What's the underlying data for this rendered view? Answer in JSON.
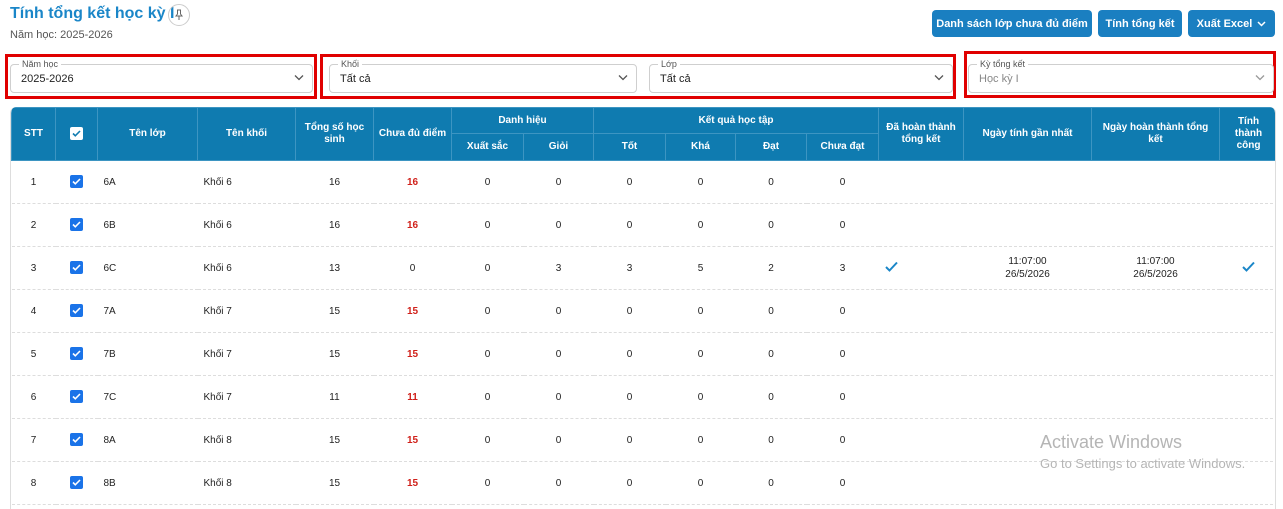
{
  "header": {
    "title": "Tính tổng kết học kỳ I",
    "subtitle": "Năm học: 2025-2026",
    "buttons": {
      "incomplete_list": "Danh sách lớp chưa đủ điểm",
      "calculate": "Tính tổng kết",
      "export": "Xuất Excel"
    }
  },
  "filters": {
    "year": {
      "label": "Năm học",
      "value": "2025-2026"
    },
    "grade": {
      "label": "Khối",
      "value": "Tất cả"
    },
    "class": {
      "label": "Lớp",
      "value": "Tất cả"
    },
    "term": {
      "label": "Kỳ tổng kết",
      "value": "Học kỳ I"
    }
  },
  "table": {
    "headers": {
      "stt": "STT",
      "class_name": "Tên lớp",
      "grade_name": "Tên khối",
      "total_students": "Tổng số học sinh",
      "incomplete": "Chưa đủ điểm",
      "titles": "Danh hiệu",
      "results": "Kết quả học tập",
      "excellent": "Xuất sắc",
      "good": "Giỏi",
      "r_good": "Tốt",
      "r_fair": "Khá",
      "r_pass": "Đạt",
      "r_fail": "Chưa đạt",
      "done": "Đã hoàn thành tổng kết",
      "last_calc": "Ngày tính gần nhất",
      "done_date": "Ngày hoàn thành tổng kết",
      "success": "Tính thành công"
    },
    "rows": [
      {
        "stt": "1",
        "checked": true,
        "class": "6A",
        "grade": "Khối 6",
        "total": "16",
        "incomplete": "16",
        "excellent": "0",
        "good": "0",
        "r_good": "0",
        "r_fair": "0",
        "r_pass": "0",
        "r_fail": "0",
        "done": false,
        "last_time": "",
        "last_date": "",
        "done_time": "",
        "done_date": "",
        "success": false
      },
      {
        "stt": "2",
        "checked": true,
        "class": "6B",
        "grade": "Khối 6",
        "total": "16",
        "incomplete": "16",
        "excellent": "0",
        "good": "0",
        "r_good": "0",
        "r_fair": "0",
        "r_pass": "0",
        "r_fail": "0",
        "done": false,
        "last_time": "",
        "last_date": "",
        "done_time": "",
        "done_date": "",
        "success": false
      },
      {
        "stt": "3",
        "checked": true,
        "class": "6C",
        "grade": "Khối 6",
        "total": "13",
        "incomplete": "0",
        "excellent": "0",
        "good": "3",
        "r_good": "3",
        "r_fair": "5",
        "r_pass": "2",
        "r_fail": "3",
        "done": true,
        "last_time": "11:07:00",
        "last_date": "26/5/2026",
        "done_time": "11:07:00",
        "done_date": "26/5/2026",
        "success": true
      },
      {
        "stt": "4",
        "checked": true,
        "class": "7A",
        "grade": "Khối 7",
        "total": "15",
        "incomplete": "15",
        "excellent": "0",
        "good": "0",
        "r_good": "0",
        "r_fair": "0",
        "r_pass": "0",
        "r_fail": "0",
        "done": false,
        "last_time": "",
        "last_date": "",
        "done_time": "",
        "done_date": "",
        "success": false
      },
      {
        "stt": "5",
        "checked": true,
        "class": "7B",
        "grade": "Khối 7",
        "total": "15",
        "incomplete": "15",
        "excellent": "0",
        "good": "0",
        "r_good": "0",
        "r_fair": "0",
        "r_pass": "0",
        "r_fail": "0",
        "done": false,
        "last_time": "",
        "last_date": "",
        "done_time": "",
        "done_date": "",
        "success": false
      },
      {
        "stt": "6",
        "checked": true,
        "class": "7C",
        "grade": "Khối 7",
        "total": "11",
        "incomplete": "11",
        "excellent": "0",
        "good": "0",
        "r_good": "0",
        "r_fair": "0",
        "r_pass": "0",
        "r_fail": "0",
        "done": false,
        "last_time": "",
        "last_date": "",
        "done_time": "",
        "done_date": "",
        "success": false
      },
      {
        "stt": "7",
        "checked": true,
        "class": "8A",
        "grade": "Khối 8",
        "total": "15",
        "incomplete": "15",
        "excellent": "0",
        "good": "0",
        "r_good": "0",
        "r_fair": "0",
        "r_pass": "0",
        "r_fail": "0",
        "done": false,
        "last_time": "",
        "last_date": "",
        "done_time": "",
        "done_date": "",
        "success": false
      },
      {
        "stt": "8",
        "checked": true,
        "class": "8B",
        "grade": "Khối 8",
        "total": "15",
        "incomplete": "15",
        "excellent": "0",
        "good": "0",
        "r_good": "0",
        "r_fair": "0",
        "r_pass": "0",
        "r_fail": "0",
        "done": false,
        "last_time": "",
        "last_date": "",
        "done_time": "",
        "done_date": "",
        "success": false
      }
    ]
  },
  "watermark": {
    "line1": "Activate Windows",
    "line2": "Go to Settings to activate Windows."
  },
  "colors": {
    "primary": "#1a7fc1",
    "header_bg": "#0f7bb0",
    "highlight_border": "#e00000",
    "incomplete_text": "#d0201a",
    "checkbox": "#1a73e8"
  }
}
